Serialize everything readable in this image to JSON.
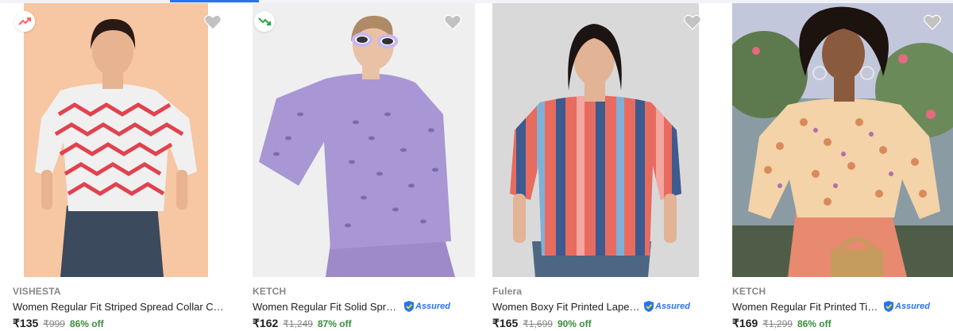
{
  "products": [
    {
      "brand": "VISHESTA",
      "title": "Women Regular Fit Striped Spread Collar Cas...",
      "price": "₹135",
      "mrp": "₹999",
      "discount": "86% off",
      "assured": false,
      "trend_icon": "trending-up-icon",
      "trend_color": "#ff6161",
      "background": "#f7c6a3"
    },
    {
      "brand": "KETCH",
      "title": "Women Regular Fit Solid Spread ...",
      "price": "₹162",
      "mrp": "₹1,249",
      "discount": "87% off",
      "assured": true,
      "trend_icon": "trending-down-icon",
      "trend_color": "#26a541",
      "background": "#f1f1f1"
    },
    {
      "brand": "Fulera",
      "title": "Women Boxy Fit Printed Lapel C...",
      "price": "₹165",
      "mrp": "₹1,699",
      "discount": "90% off",
      "assured": true,
      "background": "#d9d9d9"
    },
    {
      "brand": "KETCH",
      "title": "Women Regular Fit Printed Tie u...",
      "price": "₹169",
      "mrp": "₹1,299",
      "discount": "86% off",
      "assured": true,
      "background": "#9aa7b0"
    }
  ],
  "assured_label": "Assured",
  "colors": {
    "heart": "#c2c2c2",
    "assured_blue": "#2874f0",
    "discount_green": "#388e3c"
  }
}
